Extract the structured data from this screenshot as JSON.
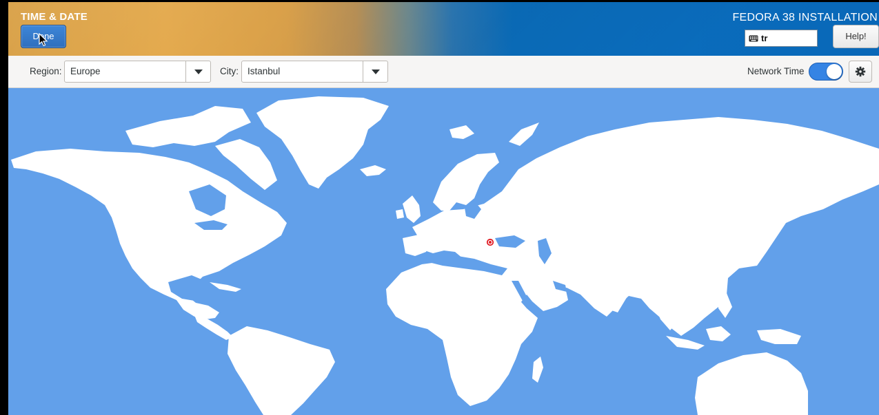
{
  "header": {
    "screen_title": "TIME & DATE",
    "done_label": "Done",
    "product_title": "FEDORA 38 INSTALLATION",
    "keyboard_layout": "tr",
    "help_label": "Help!"
  },
  "toolbar": {
    "region_label": "Region:",
    "region_value": "Europe",
    "city_label": "City:",
    "city_value": "Istanbul",
    "network_time_label": "Network Time",
    "network_time_enabled": true
  },
  "map": {
    "selected_city": "Istanbul",
    "water_color": "#62a0ea",
    "land_color": "#ffffff",
    "marker_color": "#e01b24"
  },
  "icons": [
    "keyboard-icon",
    "dropdown-arrow-icon",
    "gear-icon",
    "mouse-cursor-icon",
    "location-pin-icon"
  ]
}
